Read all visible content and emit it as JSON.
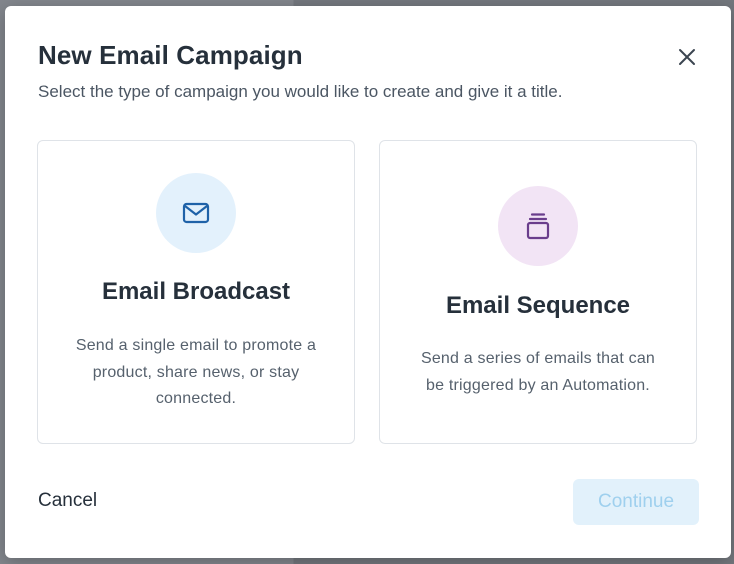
{
  "modal": {
    "title": "New Email Campaign",
    "subtitle": "Select the type of campaign you would like to create and give it a title.",
    "close_icon": "close-icon"
  },
  "options": [
    {
      "title": "Email Broadcast",
      "description": "Send a single email to promote a product, share news, or stay connected.",
      "icon": "envelope-icon",
      "icon_color": "#1f62a8",
      "icon_bg": "#e3f1fc"
    },
    {
      "title": "Email Sequence",
      "description": "Send a series of emails that can be triggered by an Automation.",
      "icon": "stack-icon",
      "icon_color": "#6a3d8c",
      "icon_bg": "#f2e4f5"
    }
  ],
  "footer": {
    "cancel_label": "Cancel",
    "continue_label": "Continue",
    "continue_disabled": true
  }
}
